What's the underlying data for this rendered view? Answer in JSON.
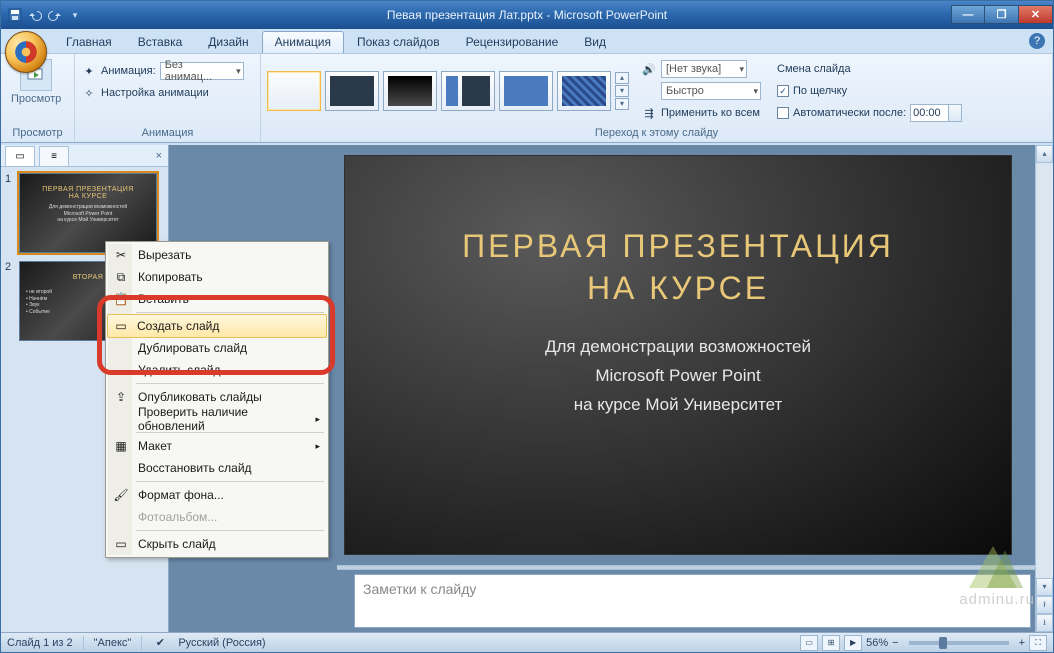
{
  "title": "Певая презентация Лат.pptx - Microsoft PowerPoint",
  "tabs": {
    "home": "Главная",
    "insert": "Вставка",
    "design": "Дизайн",
    "animation": "Анимация",
    "slideshow": "Показ слайдов",
    "review": "Рецензирование",
    "view": "Вид"
  },
  "ribbon": {
    "preview_btn": "Просмотр",
    "preview_group": "Просмотр",
    "anim_label": "Анимация:",
    "anim_value": "Без анимац...",
    "anim_settings": "Настройка анимации",
    "anim_group": "Анимация",
    "sound_value": "[Нет звука]",
    "speed_value": "Быстро",
    "apply_all": "Применить ко всем",
    "advance_title": "Смена слайда",
    "on_click": "По щелчку",
    "auto_after": "Автоматически после:",
    "auto_value": "00:00",
    "transition_group": "Переход к этому слайду"
  },
  "slide": {
    "title_l1": "Первая презентация",
    "title_l2": "на курсе",
    "sub_l1": "Для демонстрации возможностей",
    "sub_l2": "Microsoft Power Point",
    "sub_l3": "на курсе Мой Университет"
  },
  "thumbs": {
    "t1_title": "ПЕРВАЯ ПРЕЗЕНТАЦИЯ\nНА КУРСЕ",
    "t2_title": "ВТОРАЯ"
  },
  "notes_placeholder": "Заметки к слайду",
  "context_menu": {
    "cut": "Вырезать",
    "copy": "Копировать",
    "paste": "Вставить",
    "new_slide": "Создать слайд",
    "duplicate": "Дублировать слайд",
    "delete": "Удалить слайд",
    "publish": "Опубликовать слайды",
    "check_updates": "Проверить наличие обновлений",
    "layout": "Макет",
    "reset": "Восстановить слайд",
    "format_bg": "Формат фона...",
    "photo_album": "Фотоальбом...",
    "hide": "Скрыть слайд"
  },
  "statusbar": {
    "slide_of": "Слайд 1 из 2",
    "theme": "\"Апекс\"",
    "lang": "Русский (Россия)",
    "zoom": "56%"
  },
  "watermark": "adminu.ru"
}
